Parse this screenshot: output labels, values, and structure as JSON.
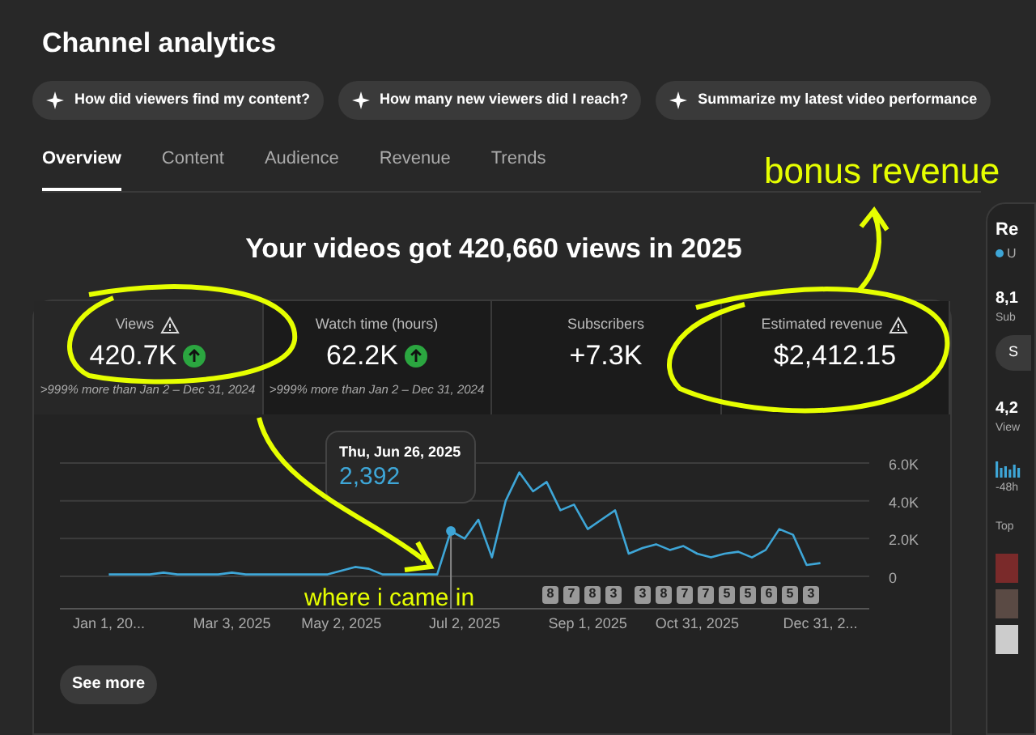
{
  "title": "Channel analytics",
  "suggestions": [
    "How did viewers find my content?",
    "How many new viewers did I reach?",
    "Summarize my latest video performance"
  ],
  "tabs": [
    {
      "label": "Overview",
      "selected": true
    },
    {
      "label": "Content",
      "selected": false
    },
    {
      "label": "Audience",
      "selected": false
    },
    {
      "label": "Revenue",
      "selected": false
    },
    {
      "label": "Trends",
      "selected": false
    }
  ],
  "headline": "Your videos got 420,660 views in 2025",
  "metrics": [
    {
      "label": "Views",
      "value": "420.7K",
      "warning": true,
      "trend_up": true,
      "comparison": ">999% more than Jan 2 – Dec 31, 2024",
      "selected": true
    },
    {
      "label": "Watch time (hours)",
      "value": "62.2K",
      "warning": false,
      "trend_up": true,
      "comparison": ">999% more than Jan 2 – Dec 31, 2024",
      "selected": false
    },
    {
      "label": "Subscribers",
      "value": "+7.3K",
      "warning": false,
      "trend_up": false,
      "selected": false
    },
    {
      "label": "Estimated revenue",
      "value": "$2,412.15",
      "warning": true,
      "trend_up": false,
      "selected": false
    }
  ],
  "chart": {
    "chart_data": {
      "type": "line",
      "categories": [
        "Jan 1, 20...",
        null,
        null,
        null,
        null,
        null,
        null,
        null,
        null,
        "Mar 3, 2025",
        null,
        null,
        null,
        null,
        null,
        null,
        null,
        "May 2, 2025",
        null,
        null,
        null,
        null,
        null,
        null,
        null,
        null,
        "Jul 2, 2025",
        null,
        null,
        null,
        null,
        null,
        null,
        null,
        null,
        "Sep 1, 2025",
        null,
        null,
        null,
        null,
        null,
        null,
        null,
        "Oct 31, 2025",
        null,
        null,
        null,
        null,
        null,
        null,
        null,
        null,
        "Dec 31, 2..."
      ],
      "series": [
        {
          "color": "#3ea6d7",
          "values": [
            100,
            100,
            100,
            100,
            200,
            100,
            100,
            100,
            100,
            200,
            100,
            100,
            100,
            100,
            100,
            100,
            100,
            300,
            500,
            400,
            100,
            100,
            100,
            100,
            100,
            2400,
            2000,
            3000,
            1000,
            4000,
            5500,
            4500,
            5000,
            3500,
            3800,
            2500,
            3000,
            3500,
            1200,
            1500,
            1700,
            1400,
            1600,
            1200,
            1000,
            1200,
            1300,
            1000,
            1400,
            2500,
            2200,
            600,
            700
          ]
        }
      ],
      "ylim": [
        0,
        6000
      ],
      "yticks": [
        {
          "value": 0,
          "label": "0"
        },
        {
          "value": 2000,
          "label": "2.0K"
        },
        {
          "value": 4000,
          "label": "4.0K"
        },
        {
          "value": 6000,
          "label": "6.0K"
        }
      ],
      "xlabel": null
    },
    "tooltip": {
      "date": "Thu, Jun 26, 2025",
      "value": "2,392"
    },
    "markers": [
      "8",
      "7",
      "8",
      "3",
      "3",
      "8",
      "7",
      "7",
      "5",
      "5",
      "6",
      "5",
      "3"
    ]
  },
  "see_more": "See more",
  "overlays": [
    {
      "kind": "text",
      "text": "bonus revenue"
    },
    {
      "kind": "text",
      "text": "where i came in"
    }
  ],
  "side_panel": {
    "title": "Re",
    "status": "U",
    "subscribers": "8,1",
    "subscribers_label": "Sub",
    "button": "S",
    "views": "4,2",
    "views_label": "View",
    "period": "-48h",
    "top_label": "Top"
  }
}
